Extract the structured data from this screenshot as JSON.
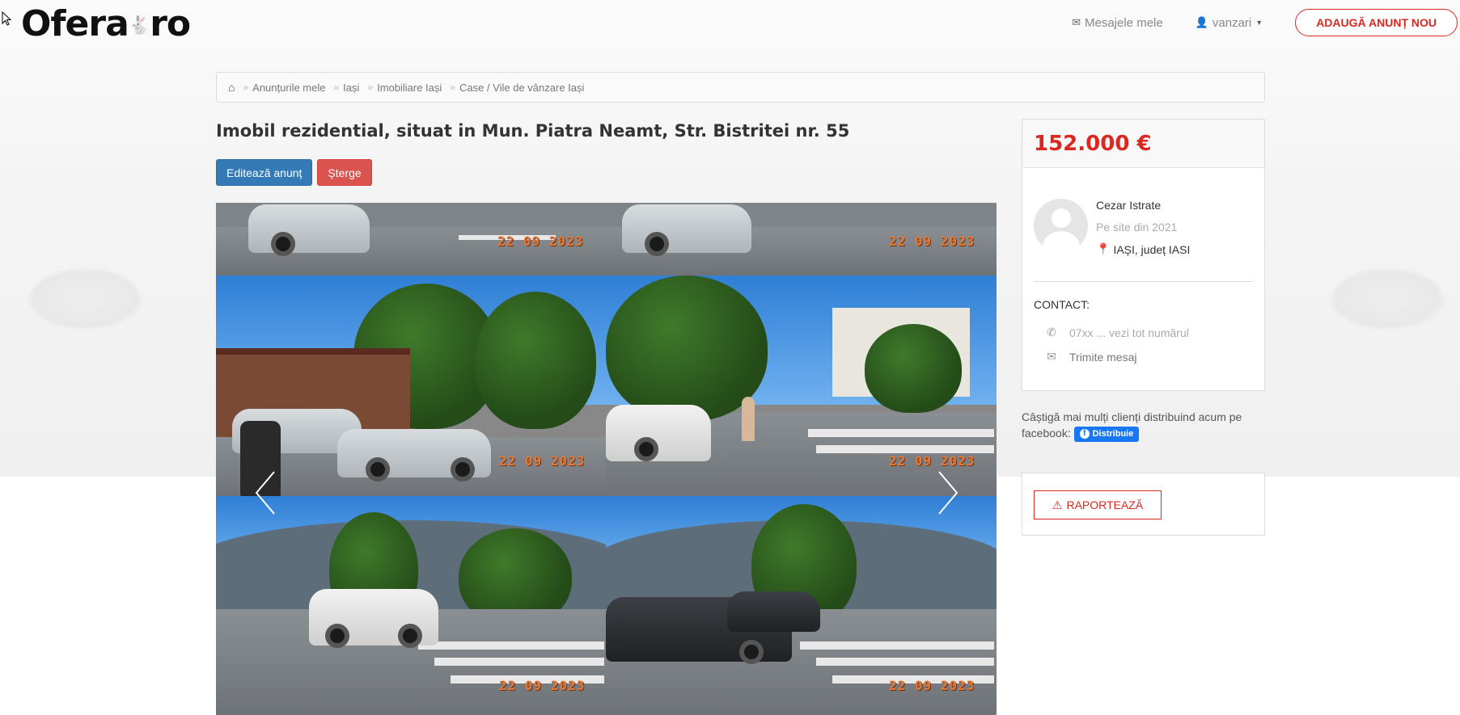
{
  "header": {
    "logo_text": "Ofera",
    "logo_suffix": "ro",
    "messages_label": "Mesajele mele",
    "user_label": "vanzari",
    "add_button_label": "ADAUGĂ ANUNȚ NOU"
  },
  "breadcrumb": {
    "items": [
      "Anunțurile mele",
      "Iași",
      "Imobiliare Iași",
      "Case / Vile de vânzare Iași"
    ]
  },
  "listing": {
    "title": "Imobil rezidential, situat in Mun. Piatra Neamt, Str. Bistritei nr. 55",
    "edit_label": "Editează anunț",
    "delete_label": "Șterge",
    "photo_stamps": [
      "22 09 2023",
      "22 09 2023",
      "22 09 2023",
      "22 09 2023",
      "22 09 2023",
      "22 09 2023"
    ]
  },
  "sidebar": {
    "price": "152.000 €",
    "seller_name": "Cezar Istrate",
    "seller_since": "Pe site din 2021",
    "seller_location": "IAȘI, județ IASI",
    "contact_label": "CONTACT:",
    "phone_label": "07xx ... vezi tot numărul",
    "message_label": "Trimite mesaj",
    "share_text": "Câștigă mai mulți clienți distribuind acum pe facebook:",
    "share_button": "Distribuie",
    "report_label": "RAPORTEAZĂ"
  },
  "colors": {
    "accent_red": "#d9281f",
    "edit_blue": "#337ab7",
    "delete_red": "#d9534f",
    "facebook_blue": "#1877f2"
  },
  "icons": {
    "messages": "envelope-icon",
    "user": "user-icon",
    "home": "home-icon",
    "location": "map-pin-icon",
    "phone": "phone-icon",
    "message": "envelope-icon",
    "report": "warning-icon",
    "prev": "chevron-left-icon",
    "next": "chevron-right-icon"
  }
}
